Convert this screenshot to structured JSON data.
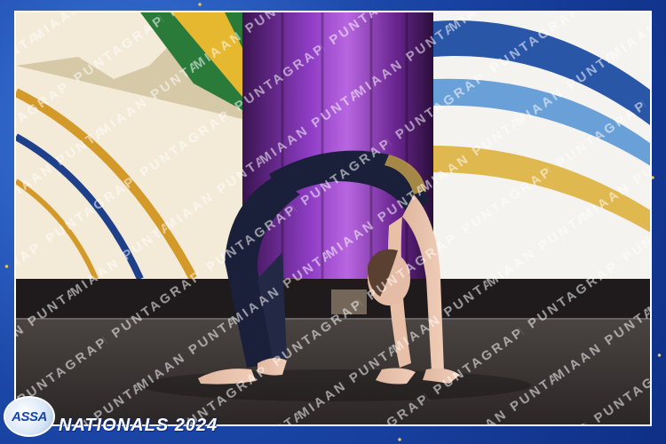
{
  "watermark": {
    "text": "MIAAN PUNTAGRAPHY"
  },
  "logo": {
    "text": "ASSA"
  },
  "event": {
    "title": "NATIONALS 2024"
  },
  "colors": {
    "frame": "#1b47a8",
    "stage_floor": "#3a3634",
    "curtain": "#7a2fa0",
    "leotard": "#1a1f3a"
  }
}
